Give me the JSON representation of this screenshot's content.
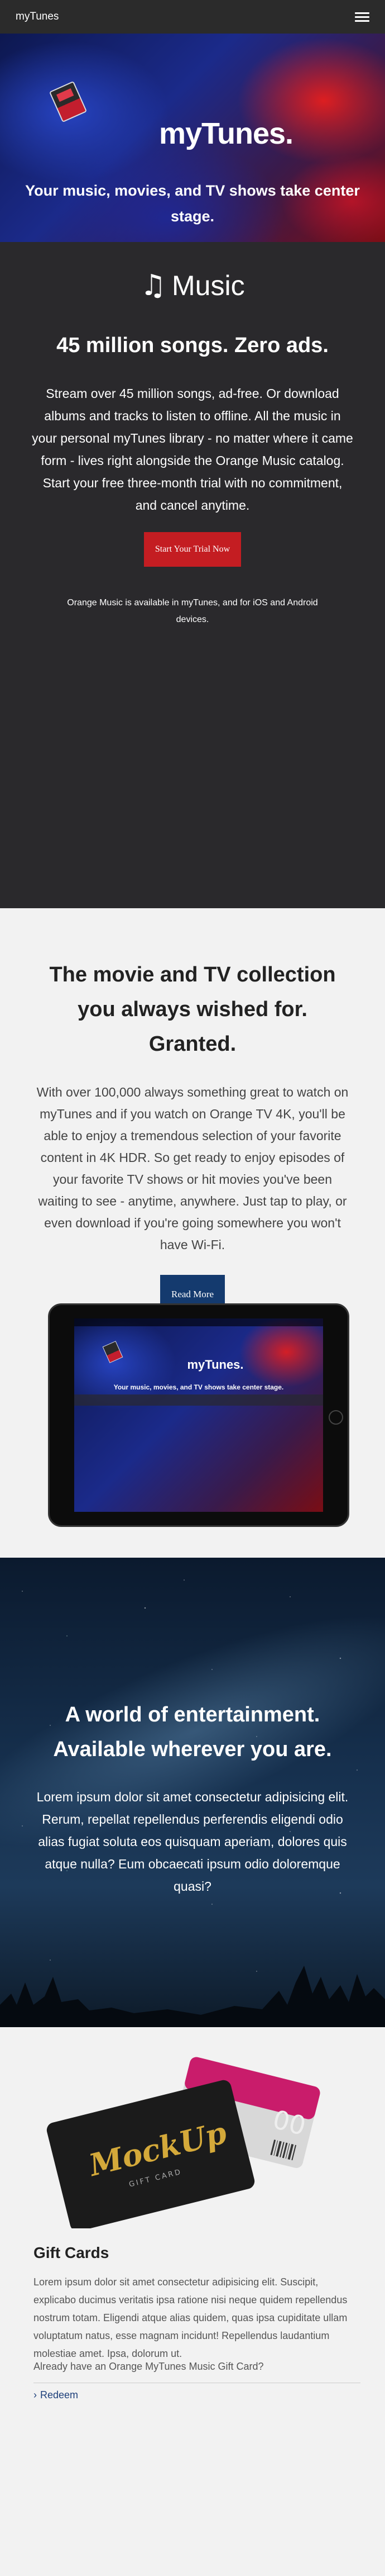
{
  "navbar": {
    "brand": "myTunes",
    "menu_icon": "hamburger-menu-icon"
  },
  "hero": {
    "title": "myTunes.",
    "subtitle": "Your music, movies, and TV shows take center stage."
  },
  "music": {
    "logo_icon": "music-note-icon",
    "logo_text": "Music",
    "heading": "45 million songs. Zero ads.",
    "body": "Stream over 45 million songs, ad-free. Or download albums and tracks to listen to offline. All the music in your personal myTunes library - no matter where it came form - lives right alongside the Orange Music catalog. Start your free three-month trial with no commitment, and cancel anytime.",
    "cta": "Start Your Trial Now",
    "availability": "Orange Music is available in myTunes, and for iOS and Android devices."
  },
  "movies": {
    "heading": "The movie and TV collection you always wished for. Granted.",
    "body": "With over 100,000 always something great to watch on myTunes and if you watch on Orange TV 4K, you'll be able to enjoy a tremendous selection of your favorite content in 4K HDR. So get ready to enjoy episodes of your favorite TV shows or hit movies you've been waiting to see - anytime, anywhere. Just tap to play, or even download if you're going somewhere you won't have Wi-Fi.",
    "cta": "Read More",
    "tablet_title": "myTunes.",
    "tablet_subtitle": "Your music, movies, and TV shows take center stage."
  },
  "world": {
    "heading": "A world of entertainment. Available wherever you are.",
    "body": "Lorem ipsum dolor sit amet consectetur adipisicing elit. Rerum, repellat repellendus perferendis eligendi odio alias fugiat soluta eos quisquam aperiam, dolores quis atque nulla? Eum obcaecati ipsum odio doloremque quasi?"
  },
  "gift": {
    "card_brand": "MockUp",
    "card_label": "GIFT CARD",
    "card_value": "00",
    "heading": "Gift Cards",
    "body": "Lorem ipsum dolor sit amet consectetur adipisicing elit. Suscipit, explicabo ducimus veritatis ipsa ratione nisi neque quidem repellendus nostrum totam. Eligendi atque alias quidem, quas ipsa cupiditate ullam voluptatum natus, esse magnam incidunt! Repellendus laudantium molestiae amet. Ipsa, dolorum ut.",
    "question": "Already have an Orange MyTunes Music Gift Card?",
    "redeem_icon": "chevron-right-icon",
    "redeem": "Redeem"
  },
  "colors": {
    "navbar": "#2b2b2b",
    "music_bg": "#2a292c",
    "red_button": "#c41d22",
    "blue_button": "#143a6e"
  }
}
